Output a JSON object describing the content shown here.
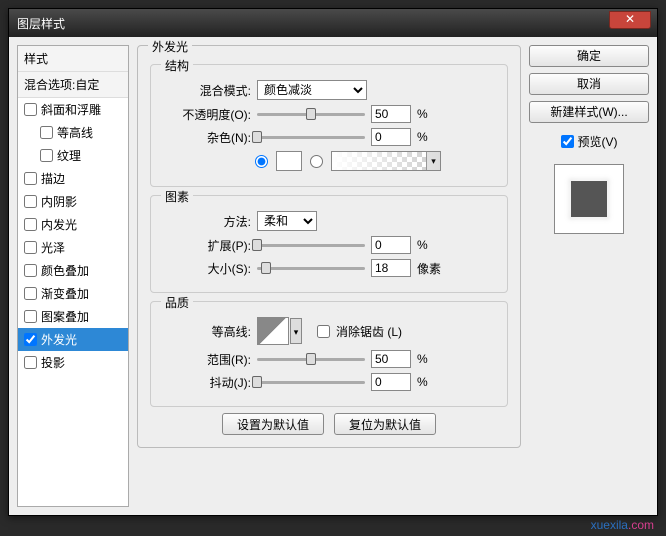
{
  "window": {
    "title": "图层样式"
  },
  "sidebar": {
    "header": "样式",
    "blend_options": "混合选项:自定",
    "items": [
      {
        "label": "斜面和浮雕",
        "checked": false,
        "indent": false
      },
      {
        "label": "等高线",
        "checked": false,
        "indent": true
      },
      {
        "label": "纹理",
        "checked": false,
        "indent": true
      },
      {
        "label": "描边",
        "checked": false,
        "indent": false
      },
      {
        "label": "内阴影",
        "checked": false,
        "indent": false
      },
      {
        "label": "内发光",
        "checked": false,
        "indent": false
      },
      {
        "label": "光泽",
        "checked": false,
        "indent": false
      },
      {
        "label": "颜色叠加",
        "checked": false,
        "indent": false
      },
      {
        "label": "渐变叠加",
        "checked": false,
        "indent": false
      },
      {
        "label": "图案叠加",
        "checked": false,
        "indent": false
      },
      {
        "label": "外发光",
        "checked": true,
        "indent": false,
        "selected": true
      },
      {
        "label": "投影",
        "checked": false,
        "indent": false
      }
    ]
  },
  "panel": {
    "title": "外发光",
    "structure": {
      "title": "结构",
      "blend_mode_label": "混合模式:",
      "blend_mode_value": "颜色减淡",
      "opacity_label": "不透明度(O):",
      "opacity_value": "50",
      "opacity_unit": "%",
      "noise_label": "杂色(N):",
      "noise_value": "0",
      "noise_unit": "%"
    },
    "elements": {
      "title": "图素",
      "technique_label": "方法:",
      "technique_value": "柔和",
      "spread_label": "扩展(P):",
      "spread_value": "0",
      "spread_unit": "%",
      "size_label": "大小(S):",
      "size_value": "18",
      "size_unit": "像素"
    },
    "quality": {
      "title": "品质",
      "contour_label": "等高线:",
      "antialias_label": "消除锯齿 (L)",
      "range_label": "范围(R):",
      "range_value": "50",
      "range_unit": "%",
      "jitter_label": "抖动(J):",
      "jitter_value": "0",
      "jitter_unit": "%"
    },
    "defaults": {
      "set_default": "设置为默认值",
      "reset_default": "复位为默认值"
    }
  },
  "actions": {
    "ok": "确定",
    "cancel": "取消",
    "new_style": "新建样式(W)...",
    "preview_label": "预览(V)",
    "preview_checked": true
  },
  "watermark": {
    "a": "xuexila",
    "b": ".com"
  }
}
